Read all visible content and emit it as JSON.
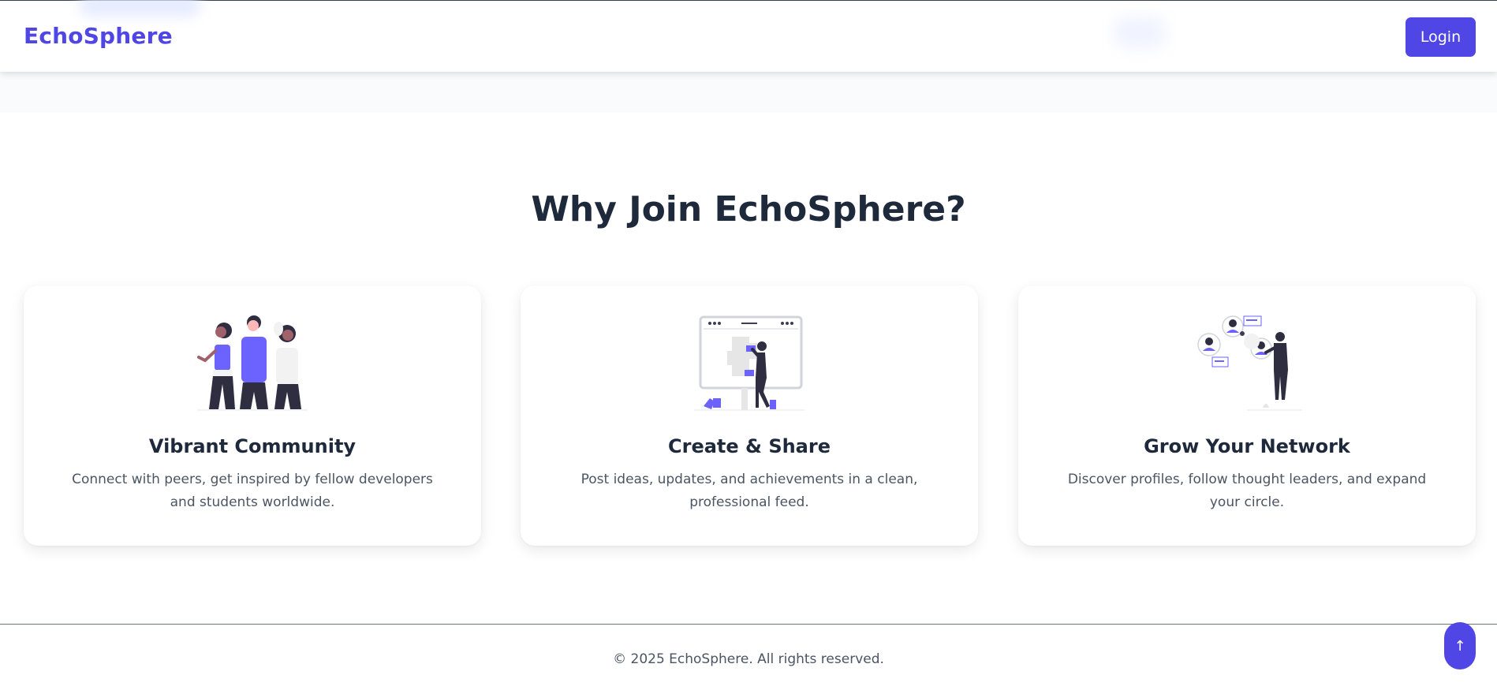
{
  "header": {
    "logo": "EchoSphere",
    "login_label": "Login"
  },
  "features": {
    "title": "Why Join EchoSphere?",
    "cards": [
      {
        "icon": "community-people-illustration",
        "title": "Vibrant Community",
        "description": "Connect with peers, get inspired by fellow developers and students worldwide."
      },
      {
        "icon": "create-share-board-illustration",
        "title": "Create & Share",
        "description": "Post ideas, updates, and achievements in a clean, professional feed."
      },
      {
        "icon": "network-profiles-illustration",
        "title": "Grow Your Network",
        "description": "Discover profiles, follow thought leaders, and expand your circle."
      }
    ]
  },
  "footer": {
    "copyright": "© 2025 EchoSphere. All rights reserved."
  },
  "scroll_top": {
    "icon": "arrow-up-icon",
    "label": "↑"
  },
  "colors": {
    "accent": "#4f46e5",
    "heading": "#1e293b",
    "body_text": "#4b5563"
  }
}
